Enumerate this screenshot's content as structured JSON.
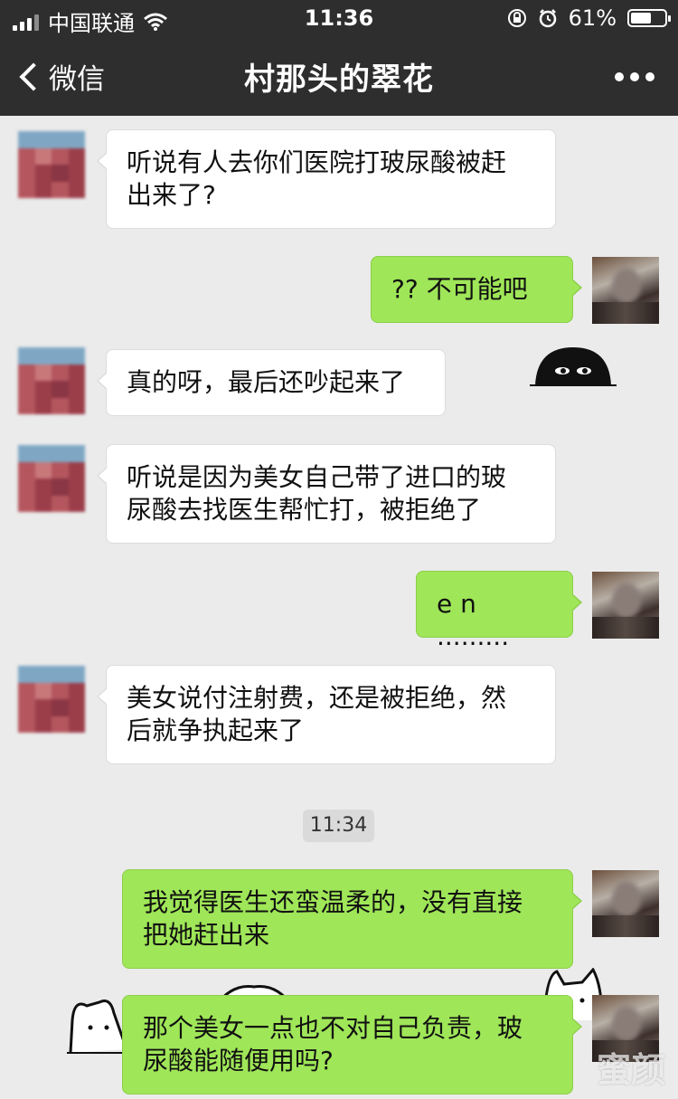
{
  "status_bar": {
    "carrier": "中国联通",
    "time": "11:36",
    "battery": "61%",
    "battery_level": 0.61
  },
  "nav": {
    "back_label": "微信",
    "title": "村那头的翠花"
  },
  "messages": [
    {
      "side": "in",
      "text": "听说有人去你们医院打玻尿酸被赶\n出来了?"
    },
    {
      "side": "out",
      "text": "?? 不可能吧"
    },
    {
      "side": "in",
      "text": "真的呀，最后还吵起来了"
    },
    {
      "side": "in",
      "text": "听说是因为美女自己带了进口的玻\n尿酸去找医生帮忙打，被拒绝了"
    },
    {
      "side": "out",
      "text": "e n ........."
    },
    {
      "side": "in",
      "text": "美女说付注射费，还是被拒绝，然\n后就争执起来了"
    },
    {
      "side": "out",
      "text": "我觉得医生还蛮温柔的，没有直接\n把她赶出来"
    },
    {
      "side": "out",
      "text": "那个美女一点也不对自己负责，玻\n尿酸能随便用吗?"
    }
  ],
  "timestamp": "11:34",
  "watermark": "蜜颜"
}
